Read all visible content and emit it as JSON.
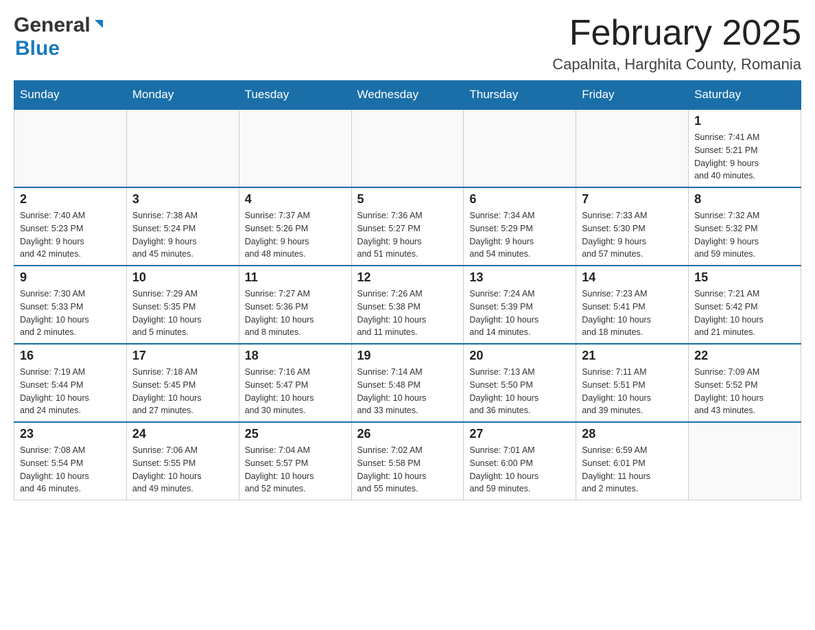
{
  "header": {
    "logo_general": "General",
    "logo_blue": "Blue",
    "month_title": "February 2025",
    "location": "Capalnita, Harghita County, Romania"
  },
  "weekdays": [
    "Sunday",
    "Monday",
    "Tuesday",
    "Wednesday",
    "Thursday",
    "Friday",
    "Saturday"
  ],
  "weeks": [
    [
      {
        "day": "",
        "info": ""
      },
      {
        "day": "",
        "info": ""
      },
      {
        "day": "",
        "info": ""
      },
      {
        "day": "",
        "info": ""
      },
      {
        "day": "",
        "info": ""
      },
      {
        "day": "",
        "info": ""
      },
      {
        "day": "1",
        "info": "Sunrise: 7:41 AM\nSunset: 5:21 PM\nDaylight: 9 hours\nand 40 minutes."
      }
    ],
    [
      {
        "day": "2",
        "info": "Sunrise: 7:40 AM\nSunset: 5:23 PM\nDaylight: 9 hours\nand 42 minutes."
      },
      {
        "day": "3",
        "info": "Sunrise: 7:38 AM\nSunset: 5:24 PM\nDaylight: 9 hours\nand 45 minutes."
      },
      {
        "day": "4",
        "info": "Sunrise: 7:37 AM\nSunset: 5:26 PM\nDaylight: 9 hours\nand 48 minutes."
      },
      {
        "day": "5",
        "info": "Sunrise: 7:36 AM\nSunset: 5:27 PM\nDaylight: 9 hours\nand 51 minutes."
      },
      {
        "day": "6",
        "info": "Sunrise: 7:34 AM\nSunset: 5:29 PM\nDaylight: 9 hours\nand 54 minutes."
      },
      {
        "day": "7",
        "info": "Sunrise: 7:33 AM\nSunset: 5:30 PM\nDaylight: 9 hours\nand 57 minutes."
      },
      {
        "day": "8",
        "info": "Sunrise: 7:32 AM\nSunset: 5:32 PM\nDaylight: 9 hours\nand 59 minutes."
      }
    ],
    [
      {
        "day": "9",
        "info": "Sunrise: 7:30 AM\nSunset: 5:33 PM\nDaylight: 10 hours\nand 2 minutes."
      },
      {
        "day": "10",
        "info": "Sunrise: 7:29 AM\nSunset: 5:35 PM\nDaylight: 10 hours\nand 5 minutes."
      },
      {
        "day": "11",
        "info": "Sunrise: 7:27 AM\nSunset: 5:36 PM\nDaylight: 10 hours\nand 8 minutes."
      },
      {
        "day": "12",
        "info": "Sunrise: 7:26 AM\nSunset: 5:38 PM\nDaylight: 10 hours\nand 11 minutes."
      },
      {
        "day": "13",
        "info": "Sunrise: 7:24 AM\nSunset: 5:39 PM\nDaylight: 10 hours\nand 14 minutes."
      },
      {
        "day": "14",
        "info": "Sunrise: 7:23 AM\nSunset: 5:41 PM\nDaylight: 10 hours\nand 18 minutes."
      },
      {
        "day": "15",
        "info": "Sunrise: 7:21 AM\nSunset: 5:42 PM\nDaylight: 10 hours\nand 21 minutes."
      }
    ],
    [
      {
        "day": "16",
        "info": "Sunrise: 7:19 AM\nSunset: 5:44 PM\nDaylight: 10 hours\nand 24 minutes."
      },
      {
        "day": "17",
        "info": "Sunrise: 7:18 AM\nSunset: 5:45 PM\nDaylight: 10 hours\nand 27 minutes."
      },
      {
        "day": "18",
        "info": "Sunrise: 7:16 AM\nSunset: 5:47 PM\nDaylight: 10 hours\nand 30 minutes."
      },
      {
        "day": "19",
        "info": "Sunrise: 7:14 AM\nSunset: 5:48 PM\nDaylight: 10 hours\nand 33 minutes."
      },
      {
        "day": "20",
        "info": "Sunrise: 7:13 AM\nSunset: 5:50 PM\nDaylight: 10 hours\nand 36 minutes."
      },
      {
        "day": "21",
        "info": "Sunrise: 7:11 AM\nSunset: 5:51 PM\nDaylight: 10 hours\nand 39 minutes."
      },
      {
        "day": "22",
        "info": "Sunrise: 7:09 AM\nSunset: 5:52 PM\nDaylight: 10 hours\nand 43 minutes."
      }
    ],
    [
      {
        "day": "23",
        "info": "Sunrise: 7:08 AM\nSunset: 5:54 PM\nDaylight: 10 hours\nand 46 minutes."
      },
      {
        "day": "24",
        "info": "Sunrise: 7:06 AM\nSunset: 5:55 PM\nDaylight: 10 hours\nand 49 minutes."
      },
      {
        "day": "25",
        "info": "Sunrise: 7:04 AM\nSunset: 5:57 PM\nDaylight: 10 hours\nand 52 minutes."
      },
      {
        "day": "26",
        "info": "Sunrise: 7:02 AM\nSunset: 5:58 PM\nDaylight: 10 hours\nand 55 minutes."
      },
      {
        "day": "27",
        "info": "Sunrise: 7:01 AM\nSunset: 6:00 PM\nDaylight: 10 hours\nand 59 minutes."
      },
      {
        "day": "28",
        "info": "Sunrise: 6:59 AM\nSunset: 6:01 PM\nDaylight: 11 hours\nand 2 minutes."
      },
      {
        "day": "",
        "info": ""
      }
    ]
  ]
}
